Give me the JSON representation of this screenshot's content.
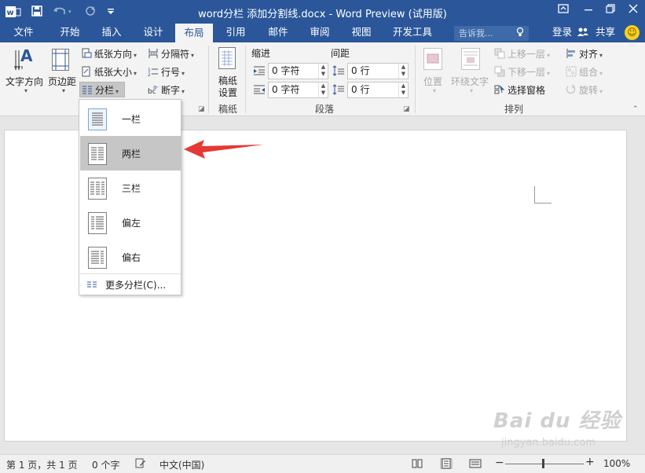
{
  "window": {
    "title": "word分栏 添加分割线.docx - Word Preview (试用版)"
  },
  "quick_access": {
    "app_icon": "word-icon",
    "save_icon": "save-icon",
    "undo_icon": "undo-icon",
    "redo_icon": "redo-icon",
    "customize_icon": "customize-quick-access-icon"
  },
  "tabs": [
    {
      "label": "文件"
    },
    {
      "label": "开始"
    },
    {
      "label": "插入"
    },
    {
      "label": "设计"
    },
    {
      "label": "布局",
      "active": true
    },
    {
      "label": "引用"
    },
    {
      "label": "邮件"
    },
    {
      "label": "审阅"
    },
    {
      "label": "视图"
    },
    {
      "label": "开发工具"
    }
  ],
  "tellme": {
    "placeholder": "告诉我..."
  },
  "account": {
    "login": "登录",
    "share": "共享"
  },
  "ribbon": {
    "page_setup": {
      "text_direction": "文字方向",
      "margins": "页边距",
      "orientation": "纸张方向",
      "size": "纸张大小",
      "columns": "分栏",
      "breaks": "分隔符",
      "line_numbers": "行号",
      "hyphenation": "断字"
    },
    "draft_paper": {
      "button_line1": "稿纸",
      "button_line2": "设置",
      "group_label": "稿纸"
    },
    "paragraph": {
      "indent_label": "缩进",
      "spacing_label": "间距",
      "indent_left": "0 字符",
      "indent_right": "0 字符",
      "spacing_before": "0 行",
      "spacing_after": "0 行",
      "group_label": "段落"
    },
    "arrange": {
      "position": "位置",
      "wrap_text": "环绕文字",
      "bring_forward": "上移一层",
      "send_backward": "下移一层",
      "selection_pane": "选择窗格",
      "align": "对齐",
      "group": "组合",
      "rotate": "旋转",
      "group_label": "排列"
    }
  },
  "columns_menu": {
    "items": [
      {
        "label": "一栏"
      },
      {
        "label": "两栏"
      },
      {
        "label": "三栏"
      },
      {
        "label": "偏左"
      },
      {
        "label": "偏右"
      }
    ],
    "more": "更多分栏(C)...",
    "hovered_index": 1
  },
  "statusbar": {
    "page": "第 1 页，共 1 页",
    "words": "0 个字",
    "language": "中文(中国)",
    "zoom": "100%",
    "zoom_minus": "−",
    "zoom_plus": "+"
  },
  "watermark": {
    "line1": "Bai du 经验",
    "line2": "jingyan.baidu.com"
  },
  "colors": {
    "title_bar": "#2b579a",
    "ribbon_bg": "#f3f3f3",
    "arrow": "#e53935",
    "hover": "#c6c6c6"
  }
}
